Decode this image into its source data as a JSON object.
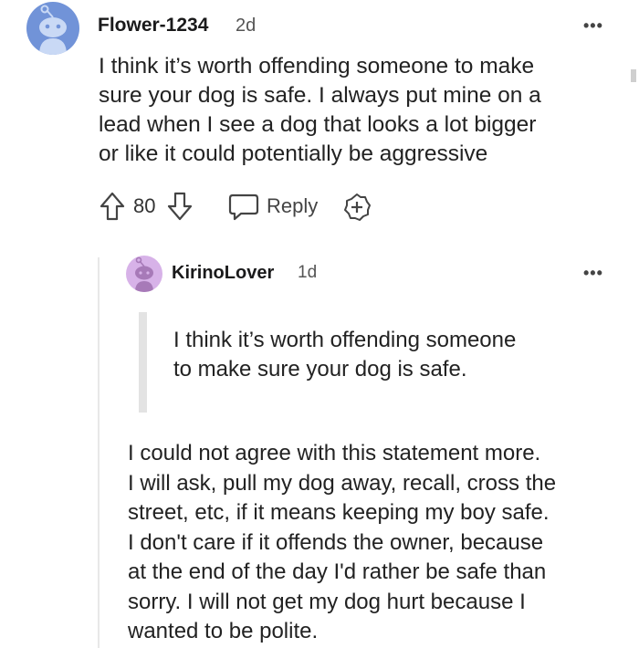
{
  "comment": {
    "username": "Flower-1234",
    "age": "2d",
    "more_label": "•••",
    "text": "I think it’s worth offending someone to make\nsure your dog is safe. I always put mine on a\nlead when I see a dog that looks a lot bigger\nor like it could potentially be aggressive",
    "votes": "80",
    "reply_label": "Reply",
    "avatar_color": "#7193d8"
  },
  "reply": {
    "username": "KirinoLover",
    "age": "1d",
    "more_label": "•••",
    "quote": "I think it’s worth offending someone\nto make sure your dog is safe.",
    "text": "I could not agree with this statement more.\nI will ask, pull my dog away, recall, cross the\nstreet, etc, if it means keeping my boy safe.\nI don't care if it offends the owner, because\nat the end of the day I'd rather be safe than\nsorry. I will not get my dog hurt because I\nwanted to be polite.",
    "avatar_color": "#d7b2e8"
  },
  "icons": [
    "upvote-icon",
    "downvote-icon",
    "reply-bubble-icon",
    "award-plus-icon",
    "more-options-icon"
  ]
}
